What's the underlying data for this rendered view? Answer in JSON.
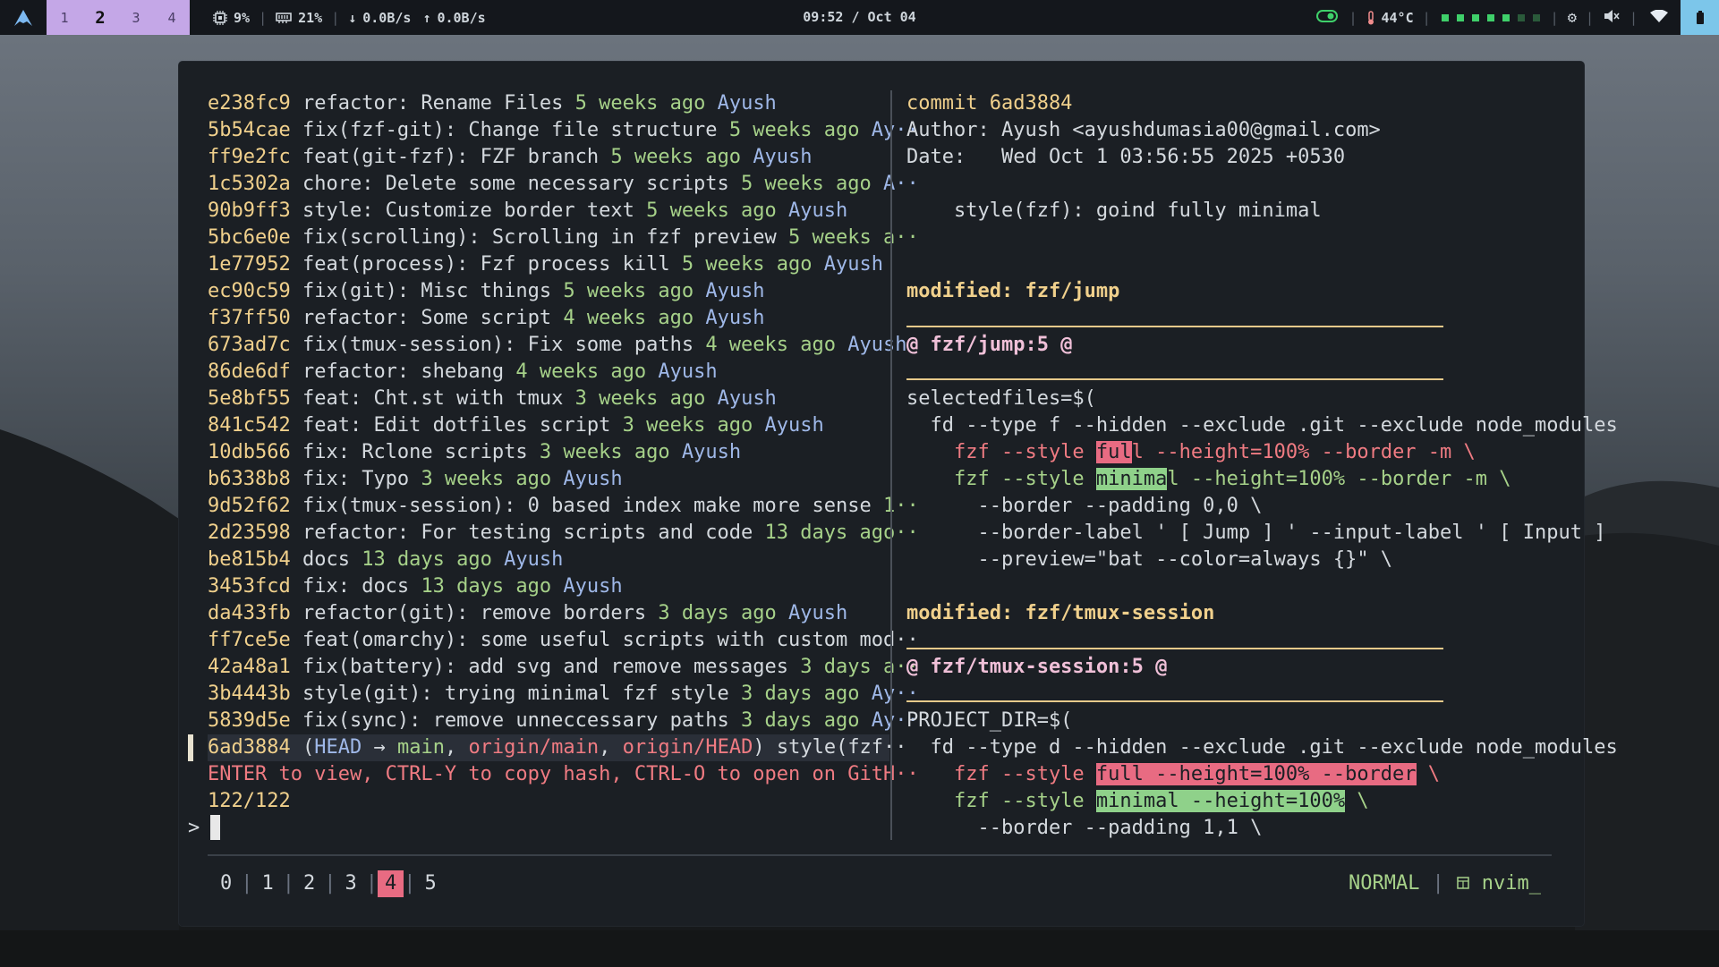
{
  "topbar": {
    "workspaces": [
      "1",
      "2",
      "3",
      "4"
    ],
    "active_workspace": "2",
    "cpu": "9%",
    "mem": "21%",
    "net_down": "0.0B/s",
    "net_up": "0.0B/s",
    "clock": "09:52 / Oct 04",
    "temp": "44°C"
  },
  "log": [
    {
      "hash": "e238fc9",
      "msg": "refactor: Rename Files",
      "time": "5 weeks ago",
      "author": "Ayush"
    },
    {
      "hash": "5b54cae",
      "msg": "fix(fzf-git): Change file structure",
      "time": "5 weeks ago",
      "author": "Ay··"
    },
    {
      "hash": "ff9e2fc",
      "msg": "feat(git-fzf): FZF branch",
      "time": "5 weeks ago",
      "author": "Ayush"
    },
    {
      "hash": "1c5302a",
      "msg": "chore: Delete some necessary scripts",
      "time": "5 weeks ago",
      "author": "A··"
    },
    {
      "hash": "90b9ff3",
      "msg": "style: Customize border text",
      "time": "5 weeks ago",
      "author": "Ayush"
    },
    {
      "hash": "5bc6e0e",
      "msg": "fix(scrolling): Scrolling in fzf preview",
      "time": "5 weeks a··",
      "author": ""
    },
    {
      "hash": "1e77952",
      "msg": "feat(process): Fzf process kill",
      "time": "5 weeks ago",
      "author": "Ayush"
    },
    {
      "hash": "ec90c59",
      "msg": "fix(git): Misc things",
      "time": "5 weeks ago",
      "author": "Ayush"
    },
    {
      "hash": "f37ff50",
      "msg": "refactor: Some script",
      "time": "4 weeks ago",
      "author": "Ayush"
    },
    {
      "hash": "673ad7c",
      "msg": "fix(tmux-session): Fix some paths",
      "time": "4 weeks ago",
      "author": "Ayush"
    },
    {
      "hash": "86de6df",
      "msg": "refactor: shebang",
      "time": "4 weeks ago",
      "author": "Ayush"
    },
    {
      "hash": "5e8bf55",
      "msg": "feat: Cht.st with tmux",
      "time": "3 weeks ago",
      "author": "Ayush"
    },
    {
      "hash": "841c542",
      "msg": "feat: Edit dotfiles script",
      "time": "3 weeks ago",
      "author": "Ayush"
    },
    {
      "hash": "10db566",
      "msg": "fix: Rclone scripts",
      "time": "3 weeks ago",
      "author": "Ayush"
    },
    {
      "hash": "b6338b8",
      "msg": "fix: Typo",
      "time": "3 weeks ago",
      "author": "Ayush"
    },
    {
      "hash": "9d52f62",
      "msg": "fix(tmux-session): 0 based index make more sense",
      "time": "1··",
      "author": ""
    },
    {
      "hash": "2d23598",
      "msg": "refactor: For testing scripts and code",
      "time": "13 days ago··",
      "author": ""
    },
    {
      "hash": "be815b4",
      "msg": "docs",
      "time": "13 days ago",
      "author": "Ayush"
    },
    {
      "hash": "3453fcd",
      "msg": "fix: docs",
      "time": "13 days ago",
      "author": "Ayush"
    },
    {
      "hash": "da433fb",
      "msg": "refactor(git): remove borders",
      "time": "3 days ago",
      "author": "Ayush"
    },
    {
      "hash": "ff7ce5e",
      "msg": "feat(omarchy): some useful scripts with custom mod··",
      "time": "",
      "author": ""
    },
    {
      "hash": "42a48a1",
      "msg": "fix(battery): add svg and remove messages",
      "time": "3 days a··",
      "author": ""
    },
    {
      "hash": "3b4443b",
      "msg": "style(git): trying minimal fzf style",
      "time": "3 days ago",
      "author": "Ay··"
    },
    {
      "hash": "5839d5e",
      "msg": "fix(sync): remove unneccessary paths",
      "time": "3 days ago",
      "author": "Ay··"
    }
  ],
  "selected": {
    "hash": "6ad3884",
    "head": "HEAD",
    "arrow": "→",
    "main": "main",
    "origin_main": "origin/main",
    "origin_head": "origin/HEAD",
    "rest": "style(fzf··"
  },
  "help_line": "ENTER to view, CTRL-Y to copy hash, CTRL-O to open on GitH··",
  "counter": "122/122",
  "prompt": ">",
  "preview": {
    "commit": "commit 6ad3884",
    "author": "Author: Ayush <ayushdumasia00@gmail.com>",
    "date": "Date:   Wed Oct 1 03:56:55 2025 +0530",
    "subject": "    style(fzf): goind fully minimal",
    "mod1": "modified: fzf/jump",
    "hunk1": "@ fzf/jump:5 @",
    "l1": "selectedfiles=$(",
    "l2": "  fd --type f --hidden --exclude .git --exclude node_modules",
    "l3a": "    fzf --style ",
    "l3b": "ful",
    "l3c": "l --height=100% --border -m \\",
    "l4a": "    fzf --style ",
    "l4b": "minima",
    "l4c": "l --height=100% --border -m \\",
    "l5": "      --border --padding 0,0 \\",
    "l6": "      --border-label ' [ Jump ] ' --input-label ' [ Input ]",
    "l7": "      --preview=\"bat --color=always {}\" \\",
    "mod2": "modified: fzf/tmux-session",
    "hunk2": "@ fzf/tmux-session:5 @",
    "m1": "PROJECT_DIR=$(",
    "m2": "  fd --type d --hidden --exclude .git --exclude node_modules",
    "m3a": "    fzf --style ",
    "m3b": "full --height=100% --border",
    "m3c": " \\",
    "m4a": "    fzf --style ",
    "m4b": "minimal --height=100%",
    "m4c": " \\",
    "m5": "      --border --padding 1,1 \\"
  },
  "tmux": {
    "windows": [
      "0",
      "1",
      "2",
      "3",
      "4",
      "5"
    ],
    "active": "4",
    "mode": "NORMAL",
    "session": "nvim_"
  }
}
